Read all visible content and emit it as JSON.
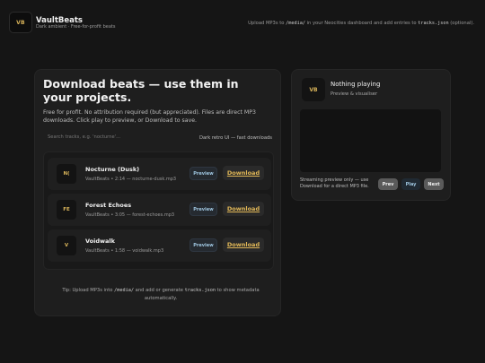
{
  "header": {
    "logo_text": "VB",
    "title": "VaultBeats",
    "subtitle": "Dark ambient · Free-for-profit beats",
    "hint_prefix": "Upload MP3s to ",
    "hint_code1": "/media/",
    "hint_mid": " in your Neocities dashboard and add entries to ",
    "hint_code2": "tracks.json",
    "hint_suffix": " (optional)."
  },
  "main": {
    "title": "Download beats — use them in your projects.",
    "description": "Free for profit. No attribution required (but appreciated). Files are direct MP3 downloads. Click play to preview, or Download to save.",
    "search_placeholder": "Search tracks, e.g. 'nocturne'...",
    "search_value": "",
    "mode_note": "Dark retro UI — fast downloads",
    "tracks": [
      {
        "thumb": "N(",
        "name": "Nocturne (Dusk)",
        "meta": "VaultBeats • 2:14 — nocturne-dusk.mp3",
        "preview_label": "Preview",
        "download_label": "Download"
      },
      {
        "thumb": "FE",
        "name": "Forest Echoes",
        "meta": "VaultBeats • 3:05 — forest-echoes.mp3",
        "preview_label": "Preview",
        "download_label": "Download"
      },
      {
        "thumb": "V",
        "name": "Voidwalk",
        "meta": "VaultBeats • 1:58 — voidwalk.mp3",
        "preview_label": "Preview",
        "download_label": "Download"
      }
    ],
    "tip_prefix": "Tip: Upload MP3s into ",
    "tip_code1": "/media/",
    "tip_mid": " and add or generate ",
    "tip_code2": "tracks.json",
    "tip_suffix": " to show metadata automatically."
  },
  "player": {
    "logo_text": "VB",
    "now_playing": "Nothing playing",
    "subtitle": "Preview & visualiser",
    "stream_note": "Streaming preview only — use Download for a direct MP3 file.",
    "prev_label": "Prev",
    "play_label": "Play",
    "next_label": "Next"
  },
  "colors": {
    "background": "#151515",
    "card": "#1e1e1e",
    "accent_gold": "#e2b857",
    "accent_blue": "#9fc6e0"
  }
}
